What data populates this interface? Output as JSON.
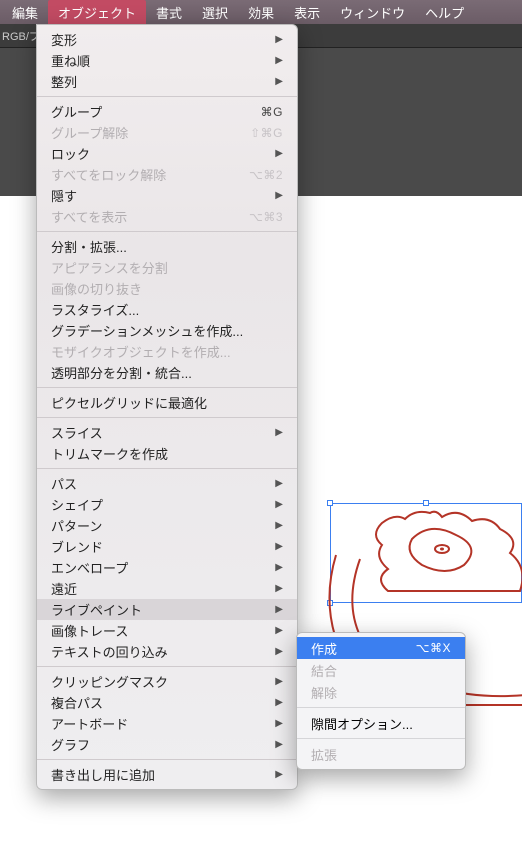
{
  "menubar": [
    "編集",
    "オブジェクト",
    "書式",
    "選択",
    "効果",
    "表示",
    "ウィンドウ",
    "ヘルプ"
  ],
  "menubar_active_index": 1,
  "docbar": "RGB/プ",
  "menu": [
    {
      "label": "変形",
      "sub": true
    },
    {
      "label": "重ね順",
      "sub": true
    },
    {
      "label": "整列",
      "sub": true
    },
    {
      "sep": true
    },
    {
      "label": "グループ",
      "sc": "⌘G"
    },
    {
      "label": "グループ解除",
      "sc": "⇧⌘G",
      "disabled": true
    },
    {
      "label": "ロック",
      "sub": true
    },
    {
      "label": "すべてをロック解除",
      "sc": "⌥⌘2",
      "disabled": true
    },
    {
      "label": "隠す",
      "sub": true
    },
    {
      "label": "すべてを表示",
      "sc": "⌥⌘3",
      "disabled": true
    },
    {
      "sep": true
    },
    {
      "label": "分割・拡張..."
    },
    {
      "label": "アピアランスを分割",
      "disabled": true
    },
    {
      "label": "画像の切り抜き",
      "disabled": true
    },
    {
      "label": "ラスタライズ..."
    },
    {
      "label": "グラデーションメッシュを作成..."
    },
    {
      "label": "モザイクオブジェクトを作成...",
      "disabled": true
    },
    {
      "label": "透明部分を分割・統合..."
    },
    {
      "sep": true
    },
    {
      "label": "ピクセルグリッドに最適化"
    },
    {
      "sep": true
    },
    {
      "label": "スライス",
      "sub": true
    },
    {
      "label": "トリムマークを作成"
    },
    {
      "sep": true
    },
    {
      "label": "パス",
      "sub": true
    },
    {
      "label": "シェイプ",
      "sub": true
    },
    {
      "label": "パターン",
      "sub": true
    },
    {
      "label": "ブレンド",
      "sub": true
    },
    {
      "label": "エンベロープ",
      "sub": true
    },
    {
      "label": "遠近",
      "sub": true
    },
    {
      "label": "ライブペイント",
      "sub": true,
      "highlight": true
    },
    {
      "label": "画像トレース",
      "sub": true
    },
    {
      "label": "テキストの回り込み",
      "sub": true
    },
    {
      "sep": true
    },
    {
      "label": "クリッピングマスク",
      "sub": true
    },
    {
      "label": "複合パス",
      "sub": true
    },
    {
      "label": "アートボード",
      "sub": true
    },
    {
      "label": "グラフ",
      "sub": true
    },
    {
      "sep": true
    },
    {
      "label": "書き出し用に追加",
      "sub": true
    }
  ],
  "submenu": [
    {
      "label": "作成",
      "sc": "⌥⌘X",
      "sel": true
    },
    {
      "label": "結合",
      "disabled": true
    },
    {
      "label": "解除",
      "disabled": true
    },
    {
      "sep": true
    },
    {
      "label": "隙間オプション..."
    },
    {
      "sep": true
    },
    {
      "label": "拡張",
      "disabled": true
    }
  ]
}
